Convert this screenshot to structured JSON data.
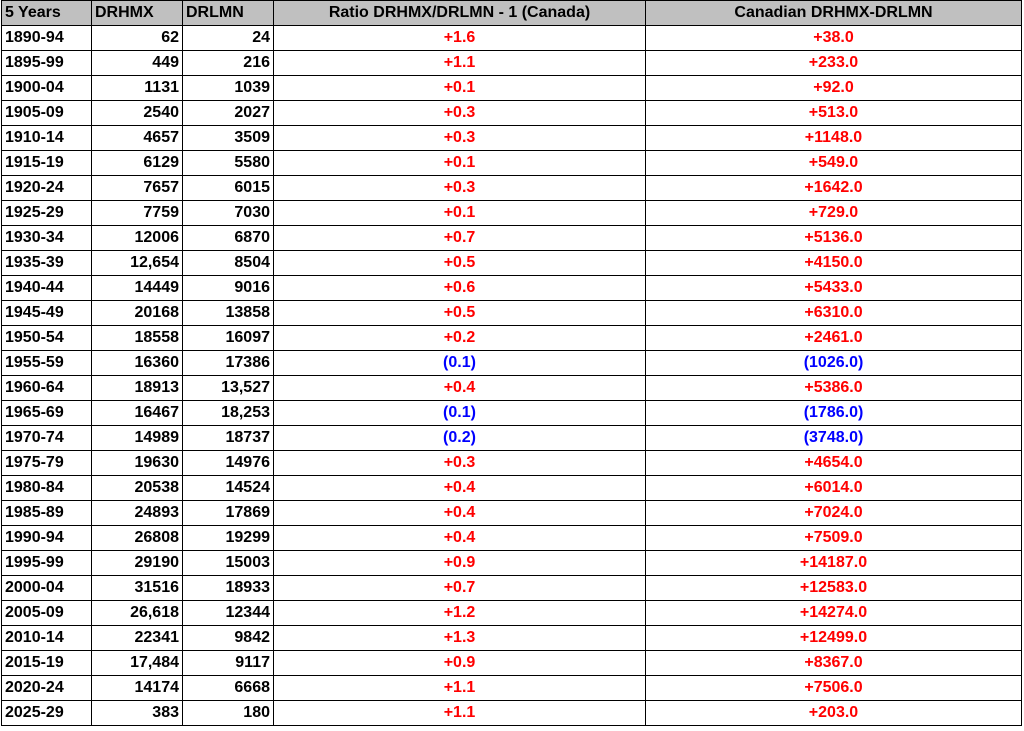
{
  "table": {
    "headers": [
      "5 Years",
      "DRHMX",
      "DRLMN",
      "Ratio DRHMX/DRLMN - 1 (Canada)",
      "Canadian DRHMX-DRLMN"
    ],
    "colors": {
      "header_bg": "#c0c0c0",
      "positive": "#ff0000",
      "negative": "#0000ff",
      "text": "#000000"
    },
    "rows": [
      {
        "period": "1890-94",
        "drhmx": "62",
        "drlmn": "24",
        "ratio": "+1.6",
        "diff": "+38.0",
        "sign": "pos"
      },
      {
        "period": "1895-99",
        "drhmx": "449",
        "drlmn": "216",
        "ratio": "+1.1",
        "diff": "+233.0",
        "sign": "pos"
      },
      {
        "period": "1900-04",
        "drhmx": "1131",
        "drlmn": "1039",
        "ratio": "+0.1",
        "diff": "+92.0",
        "sign": "pos"
      },
      {
        "period": "1905-09",
        "drhmx": "2540",
        "drlmn": "2027",
        "ratio": "+0.3",
        "diff": "+513.0",
        "sign": "pos"
      },
      {
        "period": "1910-14",
        "drhmx": "4657",
        "drlmn": "3509",
        "ratio": "+0.3",
        "diff": "+1148.0",
        "sign": "pos"
      },
      {
        "period": "1915-19",
        "drhmx": "6129",
        "drlmn": "5580",
        "ratio": "+0.1",
        "diff": "+549.0",
        "sign": "pos"
      },
      {
        "period": "1920-24",
        "drhmx": "7657",
        "drlmn": "6015",
        "ratio": "+0.3",
        "diff": "+1642.0",
        "sign": "pos"
      },
      {
        "period": "1925-29",
        "drhmx": "7759",
        "drlmn": "7030",
        "ratio": "+0.1",
        "diff": "+729.0",
        "sign": "pos"
      },
      {
        "period": "1930-34",
        "drhmx": "12006",
        "drlmn": "6870",
        "ratio": "+0.7",
        "diff": "+5136.0",
        "sign": "pos"
      },
      {
        "period": "1935-39",
        "drhmx": "12,654",
        "drlmn": "8504",
        "ratio": "+0.5",
        "diff": "+4150.0",
        "sign": "pos"
      },
      {
        "period": "1940-44",
        "drhmx": "14449",
        "drlmn": "9016",
        "ratio": "+0.6",
        "diff": "+5433.0",
        "sign": "pos"
      },
      {
        "period": "1945-49",
        "drhmx": "20168",
        "drlmn": "13858",
        "ratio": "+0.5",
        "diff": "+6310.0",
        "sign": "pos"
      },
      {
        "period": "1950-54",
        "drhmx": "18558",
        "drlmn": "16097",
        "ratio": "+0.2",
        "diff": "+2461.0",
        "sign": "pos"
      },
      {
        "period": "1955-59",
        "drhmx": "16360",
        "drlmn": "17386",
        "ratio": "(0.1)",
        "diff": "(1026.0)",
        "sign": "neg"
      },
      {
        "period": "1960-64",
        "drhmx": "18913",
        "drlmn": "13,527",
        "ratio": "+0.4",
        "diff": "+5386.0",
        "sign": "pos"
      },
      {
        "period": "1965-69",
        "drhmx": "16467",
        "drlmn": "18,253",
        "ratio": "(0.1)",
        "diff": "(1786.0)",
        "sign": "neg"
      },
      {
        "period": "1970-74",
        "drhmx": "14989",
        "drlmn": "18737",
        "ratio": "(0.2)",
        "diff": "(3748.0)",
        "sign": "neg"
      },
      {
        "period": "1975-79",
        "drhmx": "19630",
        "drlmn": "14976",
        "ratio": "+0.3",
        "diff": "+4654.0",
        "sign": "pos"
      },
      {
        "period": "1980-84",
        "drhmx": "20538",
        "drlmn": "14524",
        "ratio": "+0.4",
        "diff": "+6014.0",
        "sign": "pos"
      },
      {
        "period": "1985-89",
        "drhmx": "24893",
        "drlmn": "17869",
        "ratio": "+0.4",
        "diff": "+7024.0",
        "sign": "pos"
      },
      {
        "period": "1990-94",
        "drhmx": "26808",
        "drlmn": "19299",
        "ratio": "+0.4",
        "diff": "+7509.0",
        "sign": "pos"
      },
      {
        "period": "1995-99",
        "drhmx": "29190",
        "drlmn": "15003",
        "ratio": "+0.9",
        "diff": "+14187.0",
        "sign": "pos"
      },
      {
        "period": "2000-04",
        "drhmx": "31516",
        "drlmn": "18933",
        "ratio": "+0.7",
        "diff": "+12583.0",
        "sign": "pos"
      },
      {
        "period": "2005-09",
        "drhmx": "26,618",
        "drlmn": "12344",
        "ratio": "+1.2",
        "diff": "+14274.0",
        "sign": "pos"
      },
      {
        "period": "2010-14",
        "drhmx": "22341",
        "drlmn": "9842",
        "ratio": "+1.3",
        "diff": "+12499.0",
        "sign": "pos"
      },
      {
        "period": "2015-19",
        "drhmx": "17,484",
        "drlmn": "9117",
        "ratio": "+0.9",
        "diff": "+8367.0",
        "sign": "pos"
      },
      {
        "period": "2020-24",
        "drhmx": "14174",
        "drlmn": "6668",
        "ratio": "+1.1",
        "diff": "+7506.0",
        "sign": "pos"
      },
      {
        "period": "2025-29",
        "drhmx": "383",
        "drlmn": "180",
        "ratio": "+1.1",
        "diff": "+203.0",
        "sign": "pos"
      }
    ]
  }
}
